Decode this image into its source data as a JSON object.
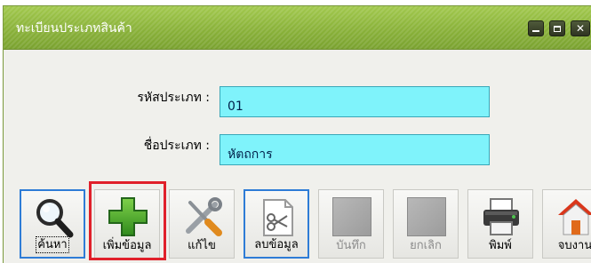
{
  "window": {
    "title": "ทะเบียนประเภทสินค้า"
  },
  "form": {
    "code_label": "รหัสประเภท :",
    "code_value": "01",
    "name_label": "ชื่อประเภท :",
    "name_value": "หัตถการ"
  },
  "toolbar": {
    "buttons": [
      {
        "label": "ค้นหา",
        "icon": "magnifier-icon",
        "enabled": true
      },
      {
        "label": "เพิ่มข้อมูล",
        "icon": "plus-icon",
        "enabled": true
      },
      {
        "label": "แก้ไข",
        "icon": "tools-icon",
        "enabled": true
      },
      {
        "label": "ลบข้อมูล",
        "icon": "scissors-document-icon",
        "enabled": true
      },
      {
        "label": "บันทึก",
        "icon": "disabled-icon",
        "enabled": false
      },
      {
        "label": "ยกเลิก",
        "icon": "disabled-icon",
        "enabled": false
      },
      {
        "label": "พิมพ์",
        "icon": "printer-icon",
        "enabled": true
      },
      {
        "label": "จบงาน",
        "icon": "home-icon",
        "enabled": true
      }
    ]
  },
  "colors": {
    "titlebar": "#8db43d",
    "field_bg": "#7ff3fb",
    "highlight": "#e0202a",
    "focus": "#2e7cd6"
  }
}
